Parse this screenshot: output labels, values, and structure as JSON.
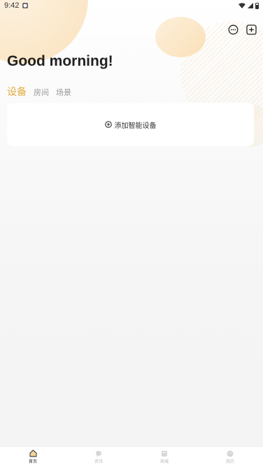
{
  "status_bar": {
    "time": "9:42",
    "notification_icon": "shield-notification-icon",
    "wifi_icon": "wifi-icon",
    "signal_icon": "cellular-signal-icon",
    "battery_icon": "battery-icon"
  },
  "header": {
    "greeting": "Good morning!",
    "actions": [
      {
        "icon": "message-icon"
      },
      {
        "icon": "add-square-icon"
      }
    ]
  },
  "tabs": [
    {
      "label": "设备",
      "active": true
    },
    {
      "label": "房间",
      "active": false
    },
    {
      "label": "场景",
      "active": false
    }
  ],
  "add_device": {
    "label": "添加智能设备",
    "icon": "plus-circle-icon"
  },
  "bottom_nav": [
    {
      "label": "首页",
      "icon": "home-icon",
      "active": true
    },
    {
      "label": "资讯",
      "icon": "chat-icon",
      "active": false
    },
    {
      "label": "商城",
      "icon": "shop-icon",
      "active": false
    },
    {
      "label": "我的",
      "icon": "profile-icon",
      "active": false
    }
  ],
  "colors": {
    "accent": "#e2ac3d",
    "home_icon": "#d9a74a",
    "text_primary": "#222222",
    "tab_inactive": "#999999",
    "card_bg": "#ffffff",
    "page_bg": "#f4f4f4"
  }
}
